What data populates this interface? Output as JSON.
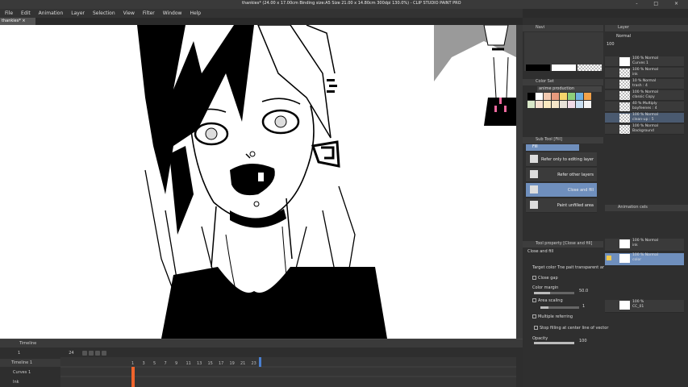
{
  "window": {
    "title": "thankies* (24.00 x 17.00cm Binding size:A5 Size 21.00 x 14.80cm 300dpi 130.0%) - CLIP STUDIO PAINT PRO",
    "controls": "- □ ×"
  },
  "menu": [
    "File",
    "Edit",
    "Animation",
    "Layer",
    "Selection",
    "View",
    "Filter",
    "Window",
    "Help"
  ],
  "doc_tab": "thankies* ×",
  "canvas": {
    "zoom": "130.0"
  },
  "timeline": {
    "tab": "Timeline",
    "frame_start": "1",
    "frame_end": "24",
    "timeline_name": "Timeline 1",
    "tracks": [
      "Curves 1",
      "Ink"
    ],
    "frame_numbers": [
      "1",
      "3",
      "5",
      "7",
      "9",
      "11",
      "13",
      "15",
      "17",
      "19",
      "21",
      "23"
    ]
  },
  "navigator": {
    "label": "Navi"
  },
  "color_set": {
    "header": "Color Set",
    "palette": "anime production",
    "swatches": [
      "#000000",
      "#ffffff",
      "#f2c9b0",
      "#e89a7d",
      "#f7d56b",
      "#8ecf7a",
      "#6fb0e0",
      "#f2a24a",
      "#d9e8c9",
      "#f7e1d0",
      "#fbe9c0",
      "#f6e6c8",
      "#e8e2d8",
      "#f0dbe6",
      "#c9dff2",
      "#f5f5f5"
    ]
  },
  "sub_tool": {
    "header": "Sub Tool [Fill]",
    "tab": "Fill",
    "items": [
      {
        "label": "Refer only to editing layer",
        "selected": false
      },
      {
        "label": "Refer other layers",
        "selected": false
      },
      {
        "label": "Close and fill",
        "selected": true
      },
      {
        "label": "Paint unfilled area",
        "selected": false
      }
    ]
  },
  "tool_property": {
    "header": "Tool property [Close and fill]",
    "tool_name": "Close and fill",
    "target_color": "Target color Tne pait transparent ar",
    "close_gap": "Close gap",
    "color_margin": "Color margin",
    "color_margin_value": "50.0",
    "area_scaling": "Area scaling",
    "area_scaling_value": "1",
    "multiple_referring": "Multiple referring",
    "stop_filling": "Stop filling at center line of vector",
    "opacity": "Opacity",
    "opacity_value": "100"
  },
  "layers": {
    "header": "Layer",
    "blend_mode": "Normal",
    "opacity": "100",
    "items": [
      {
        "line1": "100 % Normal",
        "line2": "Curves 1"
      },
      {
        "line1": "100 % Normal",
        "line2": "ink"
      },
      {
        "line1": "10 % Normal",
        "line2": "trash : 4"
      },
      {
        "line1": "100 % Normal",
        "line2": "classic Copy"
      },
      {
        "line1": "40 % Multiply",
        "line2": "bayfeenes : 4"
      },
      {
        "line1": "100 % Normal",
        "line2": "clean-up : 5"
      },
      {
        "line1": "100 % Normal",
        "line2": "Background"
      }
    ]
  },
  "animation_cels": {
    "header": "Animation cels",
    "items": [
      {
        "line1": "100 % Normal",
        "line2": "ink"
      },
      {
        "line1": "100 % Normal",
        "line2": "color"
      },
      {
        "line1": "100 %",
        "line2": "CC_01"
      }
    ]
  },
  "colors": {
    "accent": "#6f8fbd",
    "panel": "#2f2f2f",
    "timeline_marker": "#f0642c"
  }
}
